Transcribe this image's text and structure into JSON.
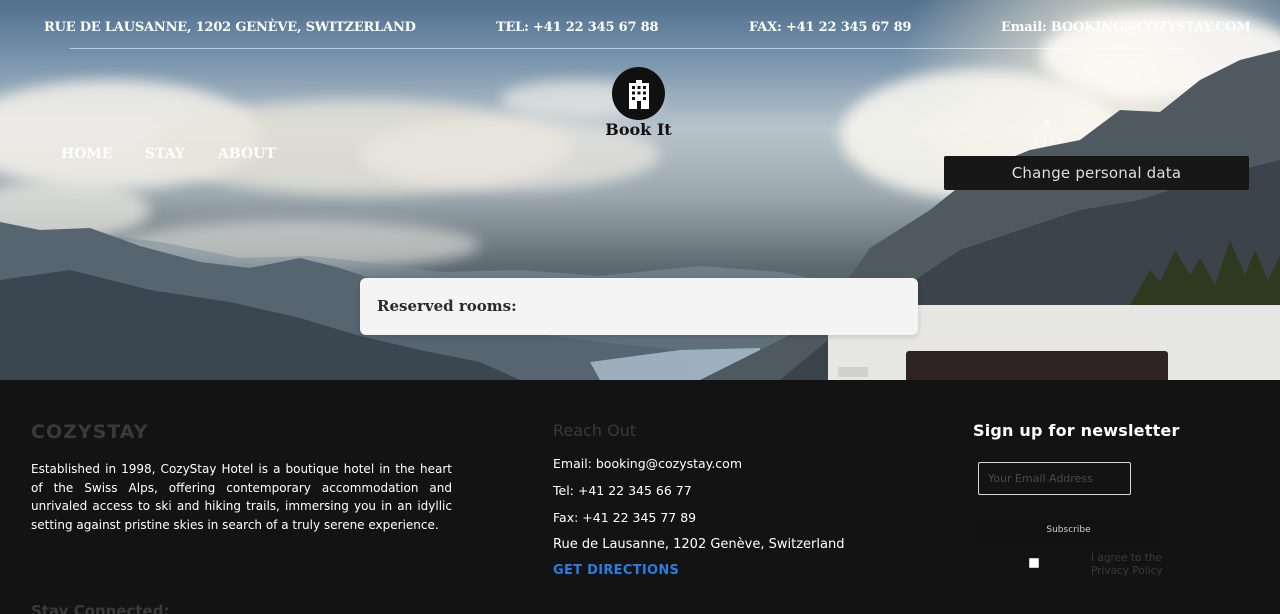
{
  "topbar": {
    "address": "RUE DE LAUSANNE, 1202 GENÈVE, SWITZERLAND",
    "tel": "TEL: +41 22 345 67 88",
    "fax": "FAX: +41 22 345 67 89",
    "email": "Email: BOOKING@COZYSTAY.COM"
  },
  "logo": {
    "text": "Book It",
    "icon": "hotel-building-icon"
  },
  "nav": {
    "items": [
      {
        "label": "HOME"
      },
      {
        "label": "STAY"
      },
      {
        "label": "ABOUT"
      }
    ]
  },
  "actions": {
    "change_personal_data": "Change personal data"
  },
  "reserved": {
    "title": "Reserved rooms:"
  },
  "footer": {
    "brand": "COZYSTAY",
    "about": "Established in 1998, CozyStay Hotel is a boutique hotel in the heart of the Swiss Alps, offering contemporary accommodation and unrivaled access to ski and hiking trails, immersing you in an idyllic setting against pristine skies in search of a truly serene experience.",
    "stay_connected": "Stay Connected:",
    "reach_out": {
      "title": "Reach Out",
      "email": "Email: booking@cozystay.com",
      "tel": "Tel: +41 22 345 66 77",
      "fax": "Fax: +41 22 345 77 89",
      "address": "Rue de Lausanne, 1202 Genève, Switzerland",
      "directions": "GET DIRECTIONS"
    },
    "newsletter": {
      "title": "Sign up for newsletter",
      "placeholder": "Your Email Address",
      "subscribe": "Subscribe",
      "agree": "I agree to the Privacy Policy"
    }
  },
  "colors": {
    "link_blue": "#2a7de1",
    "footer_bg": "#131313",
    "muted_text": "#3a3a3a",
    "button_dark": "#171717"
  }
}
